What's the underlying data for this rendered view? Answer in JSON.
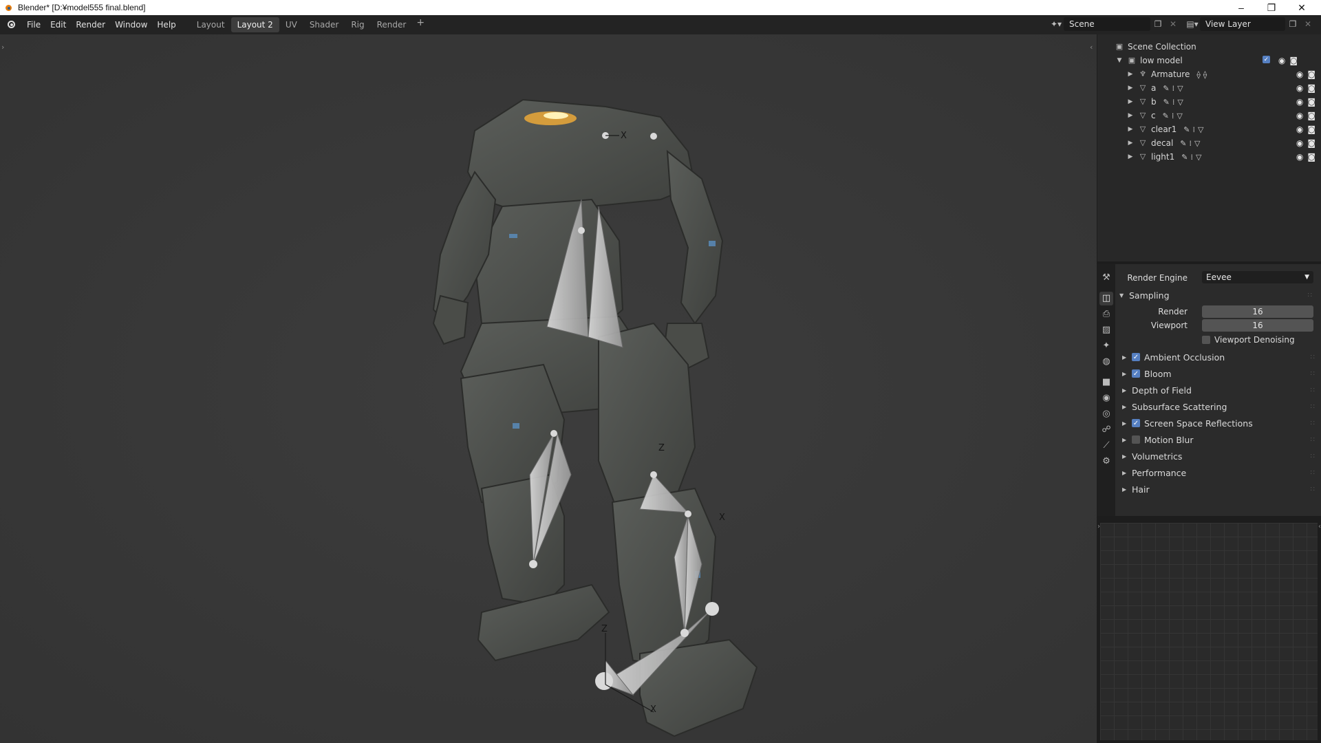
{
  "titlebar": {
    "title": "Blender* [D:¥model555 final.blend]",
    "minimize": "–",
    "restore": "❐",
    "close": "✕"
  },
  "menubar": {
    "items": [
      "File",
      "Edit",
      "Render",
      "Window",
      "Help"
    ]
  },
  "workspaces": {
    "tabs": [
      "Layout",
      "Layout 2",
      "UV",
      "Shader",
      "Rig",
      "Render"
    ],
    "active": "Layout 2",
    "add_label": "+"
  },
  "scene": {
    "value": "Scene"
  },
  "view_layer": {
    "value": "View Layer"
  },
  "outliner": {
    "root": "Scene Collection",
    "collection": "low model",
    "objects": [
      {
        "name": "Armature",
        "type": "armature"
      },
      {
        "name": "a",
        "type": "mesh"
      },
      {
        "name": "b",
        "type": "mesh"
      },
      {
        "name": "c",
        "type": "mesh"
      },
      {
        "name": "clear1",
        "type": "mesh"
      },
      {
        "name": "decal",
        "type": "mesh"
      },
      {
        "name": "light1",
        "type": "mesh"
      }
    ]
  },
  "properties": {
    "render_engine_label": "Render Engine",
    "render_engine_value": "Eevee",
    "sampling_label": "Sampling",
    "render_label": "Render",
    "render_samples": "16",
    "viewport_label": "Viewport",
    "viewport_samples": "16",
    "viewport_denoising": "Viewport Denoising",
    "panels": [
      {
        "label": "Ambient Occlusion",
        "checkbox": true,
        "checked": true
      },
      {
        "label": "Bloom",
        "checkbox": true,
        "checked": true
      },
      {
        "label": "Depth of Field",
        "checkbox": false,
        "checked": false
      },
      {
        "label": "Subsurface Scattering",
        "checkbox": false,
        "checked": false
      },
      {
        "label": "Screen Space Reflections",
        "checkbox": true,
        "checked": true
      },
      {
        "label": "Motion Blur",
        "checkbox": true,
        "checked": false
      },
      {
        "label": "Volumetrics",
        "checkbox": false,
        "checked": false
      },
      {
        "label": "Performance",
        "checkbox": false,
        "checked": false
      },
      {
        "label": "Hair",
        "checkbox": false,
        "checked": false
      }
    ]
  },
  "colors": {
    "accent": "#5680c2",
    "viewport_bg": "#3a3a3a",
    "panel_bg": "#2b2b2b"
  }
}
